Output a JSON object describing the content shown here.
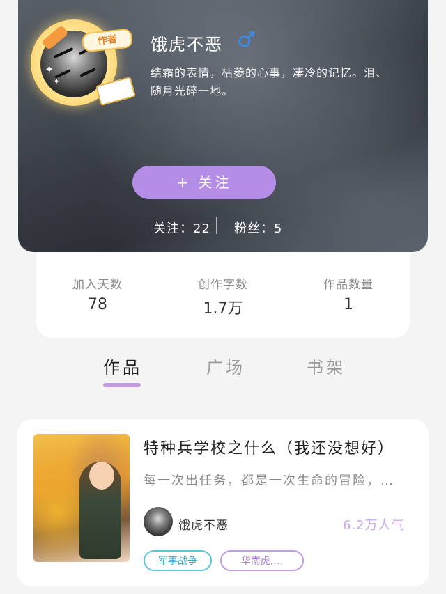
{
  "profile": {
    "author_badge": "作者",
    "name": "饿虎不恶",
    "gender_symbol": "♂",
    "bio": "结霜的表情，枯萎的心事，凄冷的记忆。泪、随月光碎一地。",
    "follow_button": "+ 关注",
    "following": "关注：22",
    "followers": "粉丝：5"
  },
  "stats": [
    {
      "label": "加入天数",
      "value": "78"
    },
    {
      "label": "创作字数",
      "value": "1.7万"
    },
    {
      "label": "作品数量",
      "value": "1"
    }
  ],
  "tabs": [
    {
      "label": "作品",
      "active": true
    },
    {
      "label": "广场",
      "active": false
    },
    {
      "label": "书架",
      "active": false
    }
  ],
  "book": {
    "title": "特种兵学校之什么（我还没想好）",
    "description": "每一次出任务，都是一次生命的冒险，…",
    "author_name": "饿虎不恶",
    "popularity": "6.2万人气",
    "tags": [
      "军事战争",
      "华南虎,…"
    ]
  },
  "colors": {
    "accent": "#b48ee6",
    "gender": "#3c8be8",
    "popularity": "#c9a6ee",
    "tag_military": "#5cc5dc",
    "tag_other": "#c39ae6"
  }
}
